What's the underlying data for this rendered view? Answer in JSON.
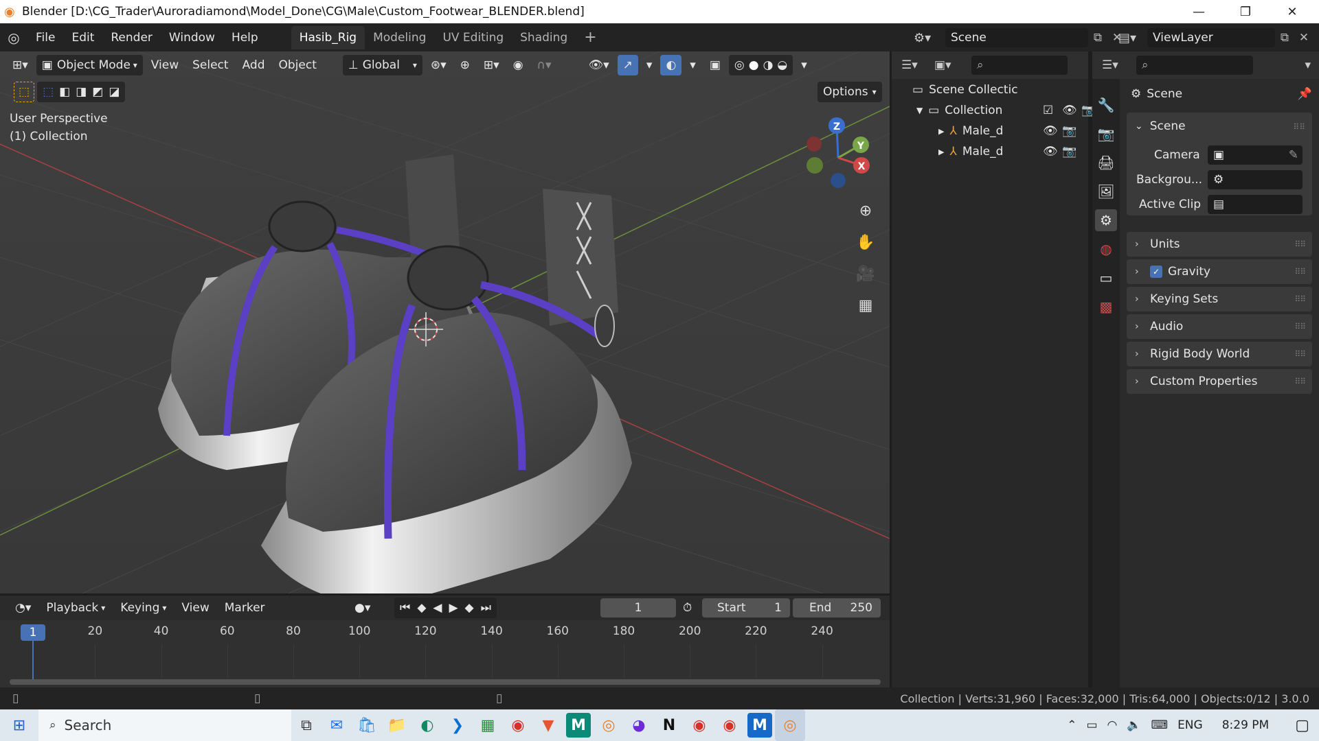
{
  "window": {
    "title": "Blender [D:\\CG_Trader\\Auroradiamond\\Model_Done\\CG\\Male\\Custom_Footwear_BLENDER.blend]",
    "minimize": "—",
    "restore": "❐",
    "close": "✕"
  },
  "menubar": {
    "items": [
      "File",
      "Edit",
      "Render",
      "Window",
      "Help"
    ],
    "workspaces": [
      "Hasib_Rig",
      "Modeling",
      "UV Editing",
      "Shading"
    ],
    "add_tab": "+",
    "scene_label": "Scene",
    "viewlayer_label": "ViewLayer"
  },
  "viewport": {
    "mode": "Object Mode",
    "menus": [
      "View",
      "Select",
      "Add",
      "Object"
    ],
    "orientation": "Global",
    "options": "Options",
    "perspective": "User Perspective",
    "collection": "(1) Collection",
    "gizmo": {
      "z": "Z",
      "y": "Y",
      "x": "X"
    }
  },
  "outliner": {
    "search_placeholder": "",
    "scene_collection": "Scene Collectic",
    "collection": "Collection",
    "children": [
      "Male_d",
      "Male_d"
    ]
  },
  "properties": {
    "header": "Scene",
    "section": "Scene",
    "camera_label": "Camera",
    "background_label": "Backgrou...",
    "active_clip_label": "Active Clip",
    "panels": [
      "Units",
      "Gravity",
      "Keying Sets",
      "Audio",
      "Rigid Body World",
      "Custom Properties"
    ],
    "gravity_checked": true
  },
  "timeline": {
    "menus": [
      "Playback",
      "Keying",
      "View",
      "Marker"
    ],
    "current_frame": "1",
    "start_label": "Start",
    "start_value": "1",
    "end_label": "End",
    "end_value": "250",
    "playhead": "1",
    "ticks": [
      "20",
      "40",
      "60",
      "80",
      "100",
      "120",
      "140",
      "160",
      "180",
      "200",
      "220",
      "240"
    ]
  },
  "status": {
    "text": "Collection | Verts:31,960 | Faces:32,000 | Tris:64,000 | Objects:0/12 | 3.0.0"
  },
  "taskbar": {
    "search": "Search",
    "lang": "ENG",
    "time": "8:29 PM"
  },
  "colors": {
    "accent_blue": "#4772b3",
    "strap_purple": "#5b3fc4",
    "axis_red": "#d04848",
    "axis_green": "#7aa64a",
    "axis_blue": "#3a6fd0"
  }
}
